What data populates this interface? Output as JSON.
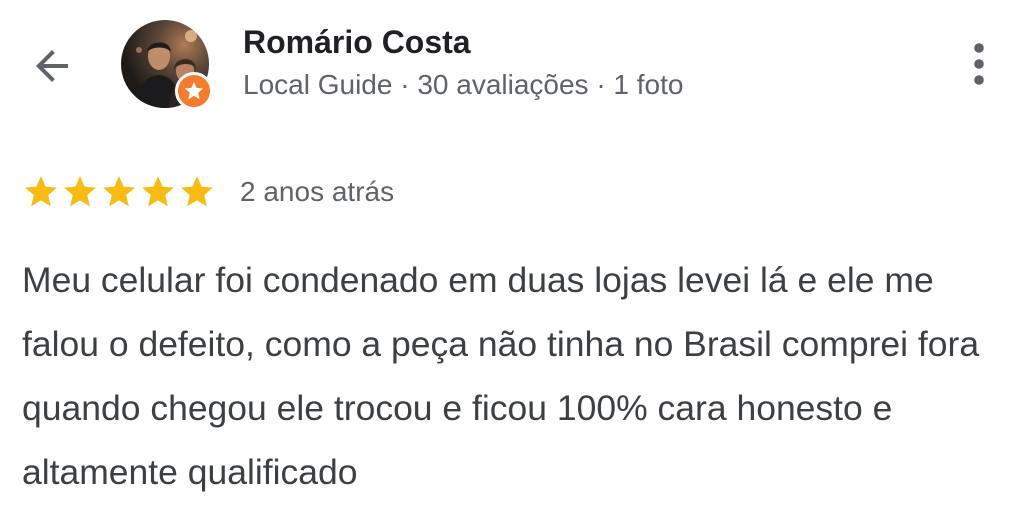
{
  "header": {
    "reviewer_name": "Romário Costa",
    "reviewer_meta": "Local Guide · 30 avaliações · 1 foto",
    "back_icon": "arrow-left-icon",
    "more_icon": "more-vertical-icon"
  },
  "review": {
    "rating": 5,
    "rating_max": 5,
    "date": "2 anos atrás",
    "text": "Meu celular foi condenado em duas lojas levei lá e ele me falou o defeito, como a peça não tinha no Brasil comprei fora quando chegou ele trocou e ficou 100% cara honesto e altamente qualificado"
  },
  "colors": {
    "star": "#f9bb0f",
    "badge": "#f57c2c",
    "name_text": "#202124",
    "meta_text": "#5f6368",
    "body_text": "#3c4043"
  }
}
